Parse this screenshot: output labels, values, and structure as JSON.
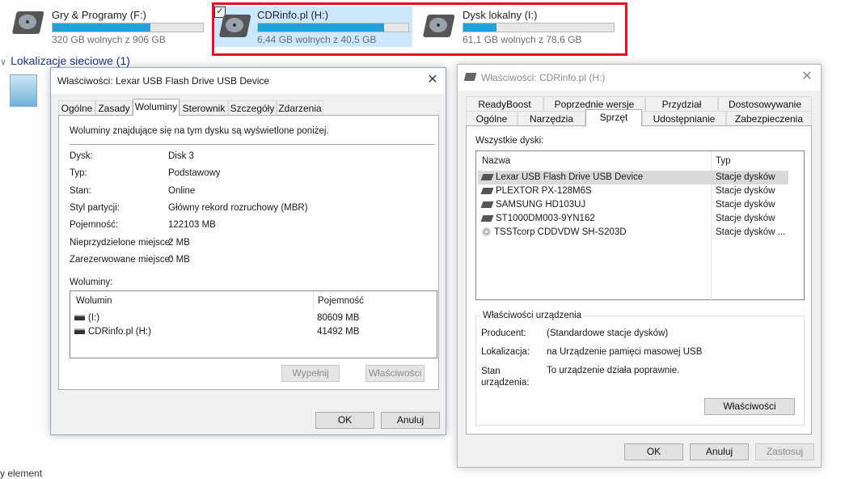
{
  "drives": [
    {
      "name": "Gry & Programy (F:)",
      "free": "320 GB wolnych z 906 GB",
      "used_fraction": 0.65,
      "selected": false
    },
    {
      "name": "CDRinfo.pl (H:)",
      "free": "6,44 GB wolnych z 40,5 GB",
      "used_fraction": 0.84,
      "selected": true
    },
    {
      "name": "Dysk lokalny (I:)",
      "free": "61,1 GB wolnych z 78,6 GB",
      "used_fraction": 0.22,
      "selected": false
    }
  ],
  "network_section": {
    "label": "Lokalizacje sieciowe (1)"
  },
  "footer_text": "y element",
  "colors": {
    "accent": "#26a0da",
    "highlight_border": "#e81123",
    "selection_bg": "#d9d9d9"
  },
  "left_dialog": {
    "title": "Właściwości: Lexar USB Flash Drive USB Device",
    "close": "✕",
    "tabs": [
      "Ogólne",
      "Zasady",
      "Woluminy",
      "Sterownik",
      "Szczegóły",
      "Zdarzenia"
    ],
    "active_tab": "Woluminy",
    "intro": "Woluminy znajdujące się na tym dysku są wyświetlone poniżej.",
    "props": [
      {
        "label": "Dysk:",
        "value": "Disk 3"
      },
      {
        "label": "Typ:",
        "value": "Podstawowy"
      },
      {
        "label": "Stan:",
        "value": "Online"
      },
      {
        "label": "Styl partycji:",
        "value": "Główny rekord rozruchowy (MBR)"
      },
      {
        "label": "Pojemność:",
        "value": "122103 MB"
      },
      {
        "label": "Nieprzydzielone miejsce:",
        "value": "2 MB"
      },
      {
        "label": "Zarezerwowane miejsce:",
        "value": "0 MB"
      }
    ],
    "volumes_label": "Woluminy:",
    "volumes_headers": [
      "Wolumin",
      "Pojemność"
    ],
    "volumes": [
      {
        "name": "(I:)",
        "size": "80609 MB"
      },
      {
        "name": "CDRinfo.pl (H:)",
        "size": "41492 MB"
      }
    ],
    "fill_button": "Wypełnij",
    "props_button": "Właściwości",
    "ok": "OK",
    "cancel": "Anuluj"
  },
  "right_dialog": {
    "title": "Właściwości: CDRinfo.pl (H:)",
    "close": "✕",
    "tabs_row1": [
      "ReadyBoost",
      "Poprzednie wersje",
      "Przydział",
      "Dostosowywanie"
    ],
    "tabs_row2": [
      "Ogólne",
      "Narzędzia",
      "Sprzęt",
      "Udostępnianie",
      "Zabezpieczenia"
    ],
    "active_tab": "Sprzęt",
    "all_disks_label": "Wszystkie dyski:",
    "headers": [
      "Nazwa",
      "Typ"
    ],
    "disks": [
      {
        "name": "Lexar USB Flash Drive USB Device",
        "type": "Stacje dysków",
        "icon": "usb-drive-icon",
        "selected": true
      },
      {
        "name": "PLEXTOR PX-128M6S",
        "type": "Stacje dysków",
        "icon": "hard-drive-icon",
        "selected": false
      },
      {
        "name": "SAMSUNG HD103UJ",
        "type": "Stacje dysków",
        "icon": "hard-drive-icon",
        "selected": false
      },
      {
        "name": "ST1000DM003-9YN162",
        "type": "Stacje dysków",
        "icon": "hard-drive-icon",
        "selected": false
      },
      {
        "name": "TSSTcorp CDDVDW SH-S203D",
        "type": "Stacje dysków ...",
        "icon": "optical-drive-icon",
        "selected": false
      }
    ],
    "device_props_group": "Właściwości urządzenia",
    "device_props": [
      {
        "label": "Producent:",
        "value": "(Standardowe stacje dysków)"
      },
      {
        "label": "Lokalizacja:",
        "value": "na Urządzenie pamięci masowej USB"
      },
      {
        "label": "Stan urządzenia:",
        "value": "To urządzenie działa poprawnie."
      }
    ],
    "props_button": "Właściwości",
    "ok": "OK",
    "cancel": "Anuluj",
    "apply": "Zastosuj"
  }
}
